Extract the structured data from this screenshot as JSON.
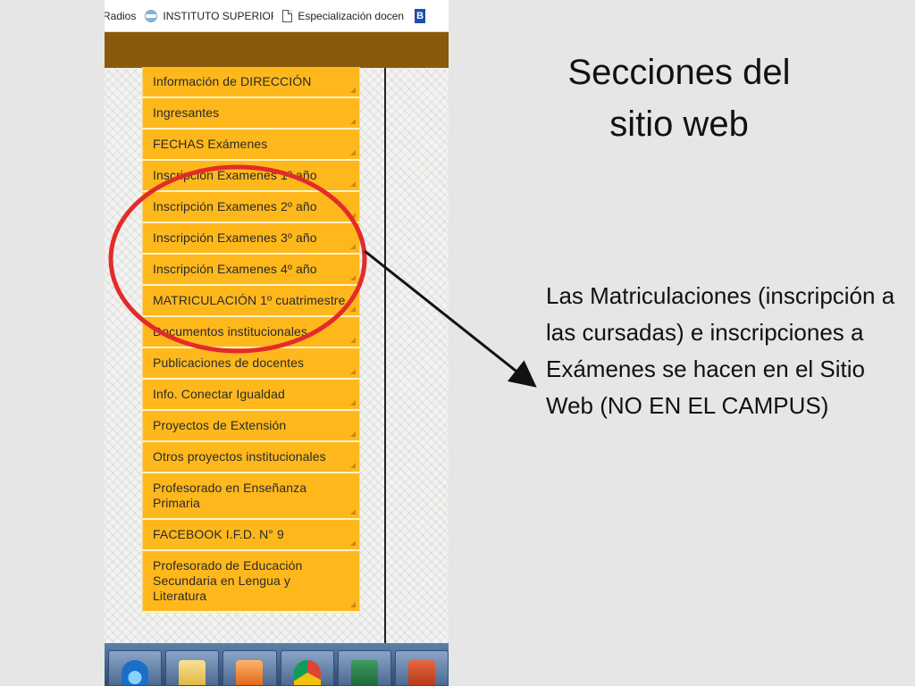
{
  "browser": {
    "bookmarks": [
      {
        "label": "Radios"
      },
      {
        "label": "INSTITUTO SUPERIOR"
      },
      {
        "label": "Especialización docen"
      }
    ],
    "bookmark_trailing_glyph": "B"
  },
  "menu": {
    "items": [
      {
        "label": "Información de DIRECCIÓN"
      },
      {
        "label": "Ingresantes"
      },
      {
        "label": "FECHAS Exámenes"
      },
      {
        "label": "Inscripción Examenes 1º año"
      },
      {
        "label": "Inscripción Examenes 2º año"
      },
      {
        "label": "Inscripción Examenes 3º año"
      },
      {
        "label": "Inscripción Examenes 4º año"
      },
      {
        "label": "MATRICULACIÓN 1º cuatrimestre"
      },
      {
        "label": "Documentos institucionales"
      },
      {
        "label": "Publicaciones de docentes"
      },
      {
        "label": "Info. Conectar Igualdad"
      },
      {
        "label": "Proyectos de Extensión"
      },
      {
        "label": "Otros proyectos institucionales"
      },
      {
        "label": "Profesorado en Enseñanza Primaria"
      },
      {
        "label": "FACEBOOK I.F.D. N° 9"
      },
      {
        "label": "Profesorado de Educación Secundaria en Lengua y Literatura"
      }
    ]
  },
  "taskbar": {
    "apps": [
      "ie-icon",
      "folder-icon",
      "media-icon",
      "chrome-icon",
      "excel-icon",
      "ppt-icon"
    ]
  },
  "slide": {
    "title": "Secciones del sitio web",
    "body": "Las Matriculaciones (inscripción  a las cursadas) e inscripciones a Exámenes  se hacen en el Sitio Web (NO EN EL CAMPUS)"
  },
  "colors": {
    "menu_item": "#ffb81c",
    "header_bar": "#8a5a0c",
    "highlight_circle": "#e32b2b",
    "arrow": "#111111",
    "slide_background": "#e6e6e6"
  }
}
